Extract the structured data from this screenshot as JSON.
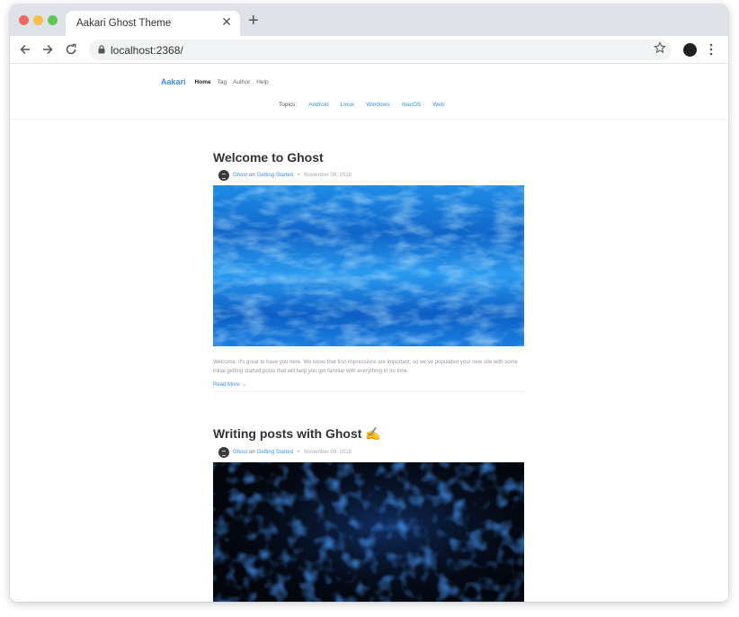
{
  "browser": {
    "tab_title": "Aakari Ghost Theme",
    "tab_close": "✕",
    "new_tab": "+",
    "url": "localhost:2368/"
  },
  "site": {
    "brand": "Aakari",
    "nav": [
      "Home",
      "Tag",
      "Author",
      "Help"
    ],
    "topics_label": "Topics:",
    "topics": [
      "Android",
      "Linux",
      "Windows",
      "macOS",
      "Web"
    ]
  },
  "posts": [
    {
      "title": "Welcome to Ghost",
      "author": "Ghost",
      "on": "on",
      "tag": "Getting Started",
      "dot": "•",
      "date": "November 09, 2018",
      "excerpt": "Welcome, it's great to have you here. We know that first impressions are important, so we've populated your new site with some initial getting started posts that will help you get familiar with everything in no time.",
      "read_more": "Read More →"
    },
    {
      "title": "Writing posts with Ghost ✍️",
      "author": "Ghost",
      "on": "on",
      "tag": "Getting Started",
      "dot": "•",
      "date": "November 09, 2018"
    }
  ],
  "colors": {
    "accent": "#3d8fe9",
    "tabstrip": "#dee1e6"
  }
}
